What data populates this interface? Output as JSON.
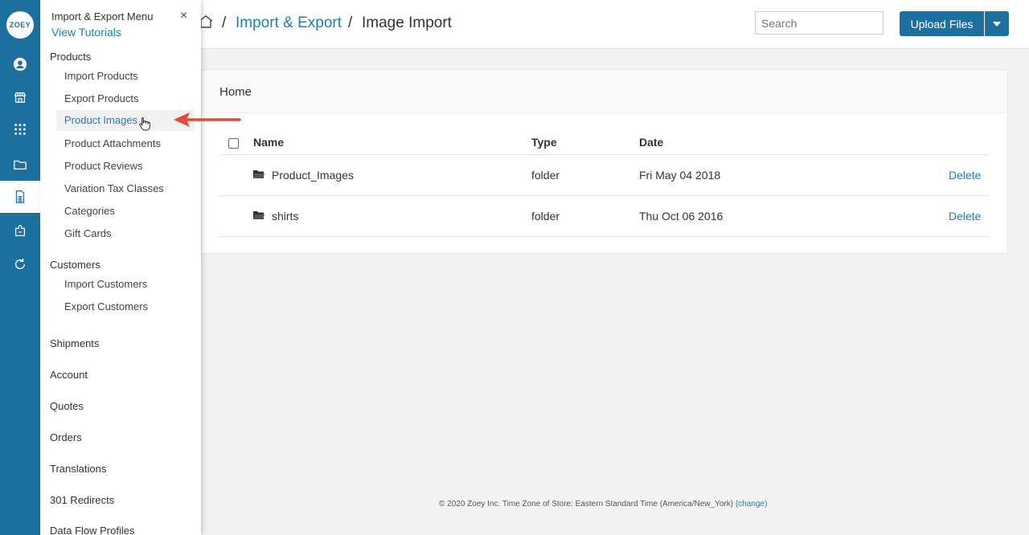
{
  "rail": {
    "logo_text": "ZOEY",
    "accent": "#1d6fa0",
    "icons": [
      "user-circle-icon",
      "storefront-icon",
      "apps-grid-icon",
      "folder-icon",
      "document-sheet-icon",
      "puzzle-icon",
      "refresh-icon"
    ]
  },
  "menu": {
    "title": "Import & Export Menu",
    "tutorials": "View Tutorials",
    "close": "×",
    "products": {
      "label": "Products",
      "items": [
        "Import Products",
        "Export Products",
        "Product Images",
        "Product Attachments",
        "Product Reviews",
        "Variation Tax Classes",
        "Categories",
        "Gift Cards"
      ]
    },
    "customers": {
      "label": "Customers",
      "items": [
        "Import Customers",
        "Export Customers"
      ]
    },
    "sections": [
      "Shipments",
      "Account",
      "Quotes",
      "Orders",
      "Translations",
      "301 Redirects",
      "Data Flow Profiles"
    ]
  },
  "breadcrumb": {
    "sep": "/",
    "section": "Import & Export",
    "current": "Image Import"
  },
  "search": {
    "placeholder": "Search"
  },
  "upload": {
    "label": "Upload Files"
  },
  "panel": {
    "heading": "Home",
    "columns": {
      "name": "Name",
      "type": "Type",
      "date": "Date"
    },
    "rows": [
      {
        "name": "Product_Images",
        "type": "folder",
        "date": "Fri May 04 2018",
        "action": "Delete"
      },
      {
        "name": "shirts",
        "type": "folder",
        "date": "Thu Oct 06 2016",
        "action": "Delete"
      }
    ]
  },
  "footer": {
    "text": "© 2020 Zoey Inc. Time Zone of Store: Eastern Standard Time (America/New_York) ",
    "change": "(change)"
  }
}
